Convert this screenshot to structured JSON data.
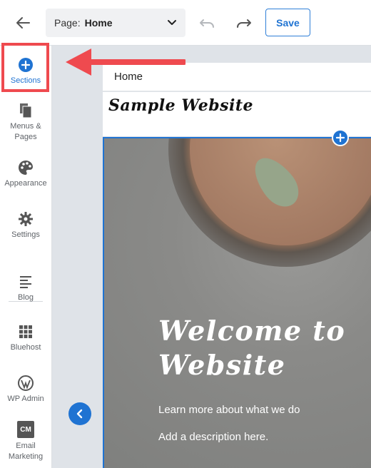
{
  "topbar": {
    "page_label": "Page:",
    "page_value": "Home",
    "save_label": "Save"
  },
  "sidebar": {
    "items": [
      {
        "label": "Sections",
        "icon": "plus-circle-icon"
      },
      {
        "label": "Menus &\nPages",
        "icon": "pages-icon"
      },
      {
        "label": "Appearance",
        "icon": "palette-icon"
      },
      {
        "label": "Settings",
        "icon": "gear-icon"
      },
      {
        "label": "Blog",
        "icon": "blog-icon"
      },
      {
        "label": "Bluehost",
        "icon": "grid-icon"
      },
      {
        "label": "WP Admin",
        "icon": "wordpress-icon"
      },
      {
        "label": "Email\nMarketing",
        "icon": "cm-icon",
        "badge": "CM"
      }
    ]
  },
  "canvas": {
    "tab_label": "Home",
    "site_title": "Sample Website",
    "hero_heading": "Welcome to\nWebsite",
    "hero_sub1": "Learn more about what we do",
    "hero_sub2": "Add a description here."
  },
  "colors": {
    "accent": "#1f73d2",
    "highlight": "#ef4a4f"
  }
}
